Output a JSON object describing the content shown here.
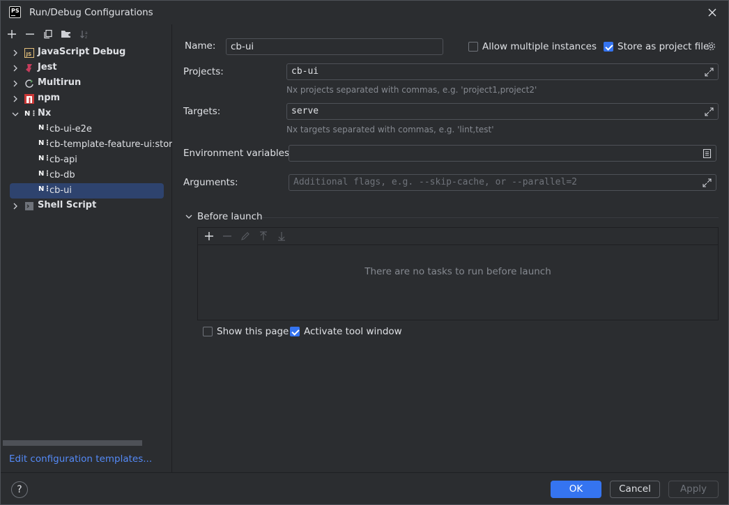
{
  "window": {
    "title": "Run/Debug Configurations",
    "logo_text": "PS"
  },
  "left_toolbar": [
    "add-icon",
    "remove-icon",
    "copy-icon",
    "folder-icon",
    "sort-icon"
  ],
  "tree": {
    "categories": [
      {
        "label": "JavaScript Debug",
        "icon": "js-icon",
        "expanded": false
      },
      {
        "label": "Jest",
        "icon": "jest-icon",
        "expanded": false
      },
      {
        "label": "Multirun",
        "icon": "multirun-icon",
        "expanded": false
      },
      {
        "label": "npm",
        "icon": "npm-icon",
        "expanded": false
      },
      {
        "label": "Nx",
        "icon": "nx-icon",
        "expanded": true
      },
      {
        "label": "Shell Script",
        "icon": "shell-icon",
        "expanded": false
      }
    ],
    "nx_children": [
      "cb-ui-e2e",
      "cb-template-feature-ui:stor",
      "cb-api",
      "cb-db",
      "cb-ui"
    ],
    "nx_icon_text": "N⋮",
    "selected": "cb-ui"
  },
  "edit_templates": "Edit configuration templates...",
  "form": {
    "name_label": "Name:",
    "name_value": "cb-ui",
    "allow_multiple_label": "Allow multiple instances",
    "allow_multiple_checked": false,
    "store_as_project_label": "Store as project file",
    "store_as_project_checked": true,
    "projects_label": "Projects:",
    "projects_value": "cb-ui",
    "projects_hint": "Nx projects separated with commas, e.g. 'project1,project2'",
    "targets_label": "Targets:",
    "targets_value": "serve",
    "targets_hint": "Nx targets separated with commas, e.g. 'lint,test'",
    "env_label": "Environment variables:",
    "env_value": "",
    "args_label": "Arguments:",
    "args_placeholder": "Additional flags, e.g. --skip-cache, or --parallel=2"
  },
  "before_launch": {
    "title": "Before launch",
    "empty_text": "There are no tasks to run before launch",
    "show_page_label": "Show this page",
    "show_page_checked": false,
    "activate_tool_label": "Activate tool window",
    "activate_tool_checked": true
  },
  "buttons": {
    "ok": "OK",
    "cancel": "Cancel",
    "apply": "Apply",
    "help": "?"
  },
  "colors": {
    "accent": "#3574f0",
    "link": "#548af7",
    "background": "#2b2d30",
    "selection": "#2e436e"
  }
}
